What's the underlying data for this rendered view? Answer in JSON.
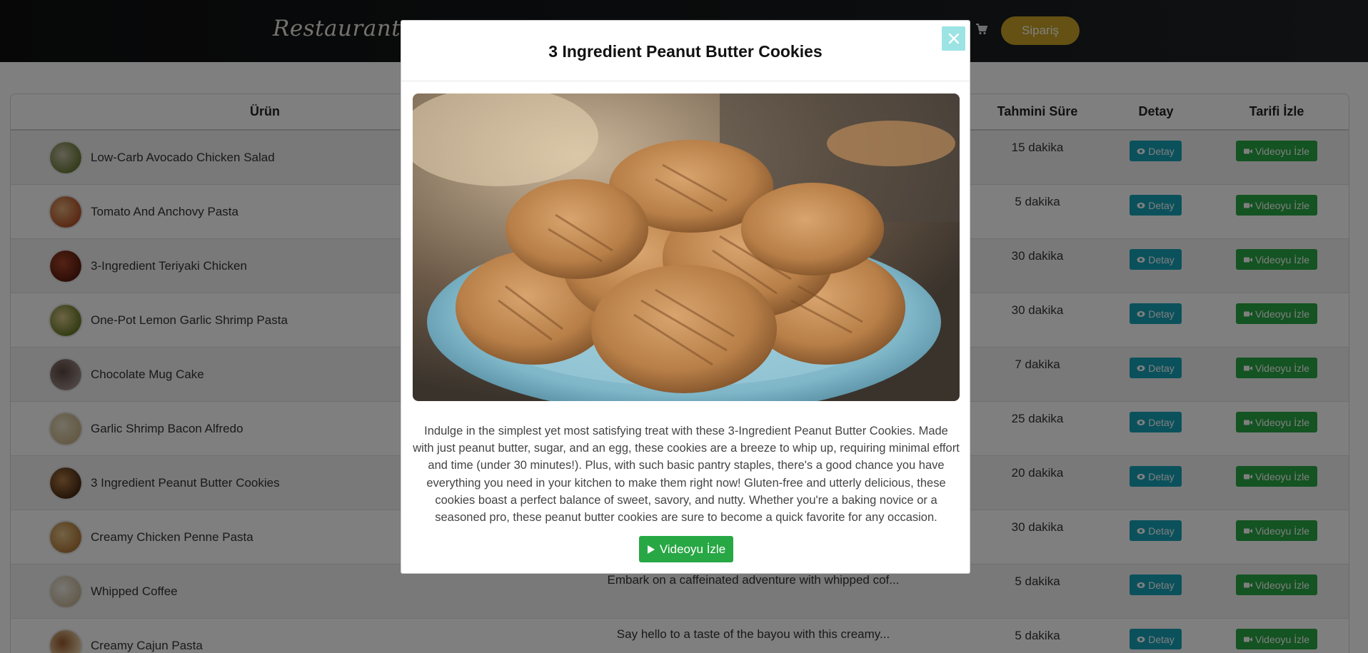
{
  "navbar": {
    "brand": "Restaurant",
    "cart_icon": "shopping-cart-icon",
    "order_button": "Sipariş",
    "accent_color": "#c9a227"
  },
  "table": {
    "headers": {
      "product": "Ürün",
      "time": "Tahmini Süre",
      "detail": "Detay",
      "video": "Tarifi İzle"
    },
    "detail_button": "Detay",
    "detail_icon": "eye-icon",
    "video_button": "Videoyu İzle",
    "video_icon": "video-camera-icon",
    "rows": [
      {
        "name": "Low-Carb Avocado Chicken Salad",
        "description": "",
        "time": "15 dakika"
      },
      {
        "name": "Tomato And Anchovy Pasta",
        "description": "",
        "time": "5 dakika"
      },
      {
        "name": "3-Ingredient Teriyaki Chicken",
        "description": "",
        "time": "30 dakika"
      },
      {
        "name": "One-Pot Lemon Garlic Shrimp Pasta",
        "description": "",
        "time": "30 dakika"
      },
      {
        "name": "Chocolate Mug Cake",
        "description": "",
        "time": "7 dakika"
      },
      {
        "name": "Garlic Shrimp Bacon Alfredo",
        "description": "",
        "time": "25 dakika"
      },
      {
        "name": "3 Ingredient Peanut Butter Cookies",
        "description": "",
        "time": "20 dakika"
      },
      {
        "name": "Creamy Chicken Penne Pasta",
        "description": "",
        "time": "30 dakika"
      },
      {
        "name": "Whipped Coffee",
        "description": "Embark on a caffeinated adventure with whipped cof...",
        "time": "5 dakika"
      },
      {
        "name": "Creamy Cajun Pasta",
        "description": "Say hello to a taste of the bayou with this creamy...",
        "time": "5 dakika"
      }
    ]
  },
  "modal": {
    "title": "3 Ingredient Peanut Butter Cookies",
    "close_icon": "close-icon",
    "description": "Indulge in the simplest yet most satisfying treat with these 3-Ingredient Peanut Butter Cookies. Made with just peanut butter, sugar, and an egg, these cookies are a breeze to whip up, requiring minimal effort and time (under 30 minutes!). Plus, with such basic pantry staples, there's a good chance you have everything you need in your kitchen to make them right now! Gluten-free and utterly delicious, these cookies boast a perfect balance of sweet, savory, and nutty. Whether you're a baking novice or a seasoned pro, these peanut butter cookies are sure to become a quick favorite for any occasion.",
    "video_button": "Videoyu İzle",
    "play_icon": "play-icon"
  }
}
